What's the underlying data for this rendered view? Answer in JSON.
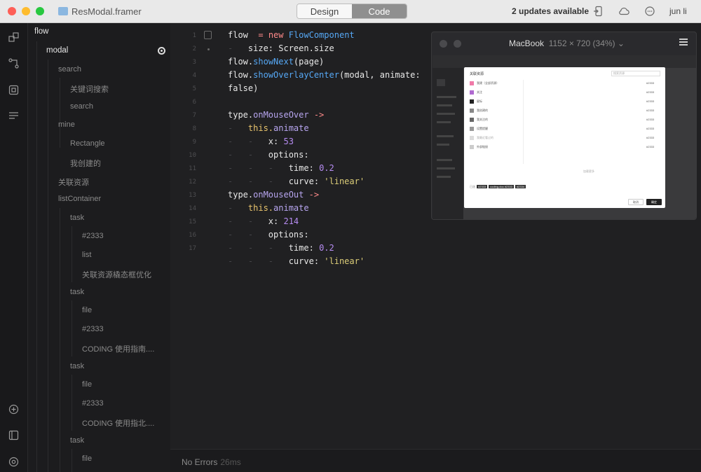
{
  "window": {
    "file_title": "ResModal.framer",
    "tabs": {
      "design": "Design",
      "code": "Code"
    },
    "updates": "2 updates available",
    "user": "jun li"
  },
  "tree": {
    "flow": "flow",
    "modal": "modal",
    "search": "search",
    "search_keyword": "关键词搜索",
    "search_child": "search",
    "mine": "mine",
    "rectangle": "Rectangle",
    "created": "我创建的",
    "related": "关联资源",
    "list_container": "listContainer",
    "task1": "task",
    "t1_id": "#2333",
    "t1_list": "list",
    "t1_opt": "关联资源橇态框优化",
    "task2": "task",
    "t2_file": "file",
    "t2_id": "#2333",
    "t2_guide": "CODING 使用指南....",
    "task3": "task",
    "t3_file": "file",
    "t3_id": "#2333",
    "t3_guide": "CODING 使用指北....",
    "task4": "task",
    "t4_file": "file"
  },
  "code": {
    "line_numbers": [
      "1",
      "2",
      "3",
      "4",
      "5",
      "6",
      "7",
      "8",
      "9",
      "10",
      "11",
      "12",
      "13",
      "14",
      "15",
      "16",
      "17"
    ],
    "l1a": "flow",
    "l1b": "  = ",
    "l1c": "new",
    "l1d": " FlowComponent",
    "l2a": "size: Screen.size",
    "l3a": "flow.",
    "l3b": "showNext",
    "l3c": "(page)",
    "l4a": "flow.",
    "l4b": "showOverlayCenter",
    "l4c": "(modal, animate:",
    "l4d": "false)",
    "l6a": "type.",
    "l6b": "onMouseOver",
    "l6c": " ->",
    "l7a": "this.",
    "l7b": "animate",
    "l8a": "x: ",
    "l8b": "53",
    "l9a": "options:",
    "l10a": "time: ",
    "l10b": "0.2",
    "l11a": "curve: ",
    "l11b": "'linear'",
    "l12a": "type.",
    "l12b": "onMouseOut",
    "l12c": " ->",
    "l13a": "this.",
    "l13b": "animate",
    "l14a": "x: ",
    "l14b": "214",
    "l15a": "options:",
    "l16a": "time: ",
    "l16b": "0.2",
    "l17a": "curve: ",
    "l17b": "'linear'"
  },
  "status": {
    "text": "No Errors",
    "time": "26ms"
  },
  "preview": {
    "device": "MacBook",
    "resolution": "1152 × 720 (34%)",
    "modal_title": "关联资源",
    "modal_search": "搜索资源",
    "rows_left": [
      "我建（全部资源）",
      "关注",
      "星标",
      "我创建的",
      "我关注的",
      "设置提醒",
      "我最近看过的",
      "外部链接"
    ],
    "rows_right": [
      "#2333",
      "#2333",
      "#2333",
      "#2333",
      "#2333",
      "#2333",
      "#2333",
      "#2333"
    ],
    "more": "加载更多",
    "tag_label": "已选",
    "tag1": "#2333",
    "tag2": "coding-doc #2333",
    "tag3": "#2334",
    "cancel": "取消",
    "ok": "确定"
  }
}
